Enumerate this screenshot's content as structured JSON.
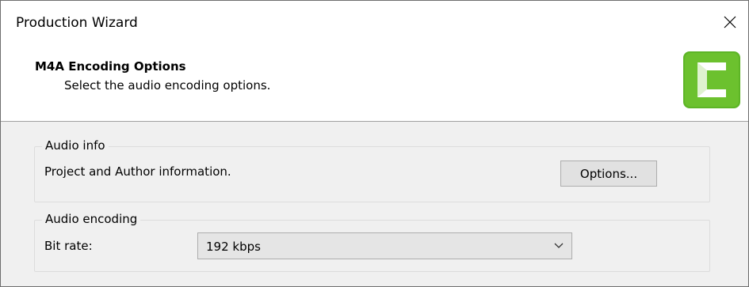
{
  "window": {
    "title": "Production Wizard"
  },
  "header": {
    "title": "M4A Encoding Options",
    "subtitle": "Select the audio encoding options."
  },
  "audio_info": {
    "legend": "Audio info",
    "description": "Project and Author information.",
    "options_button": "Options..."
  },
  "audio_encoding": {
    "legend": "Audio encoding",
    "bit_rate_label": "Bit rate:",
    "bit_rate_value": "192 kbps"
  },
  "icons": {
    "close": "close-icon",
    "logo": "camtasia-logo-icon",
    "dropdown": "chevron-down-icon"
  },
  "colors": {
    "logo_green": "#5db526",
    "logo_light": "#7fd43a"
  }
}
